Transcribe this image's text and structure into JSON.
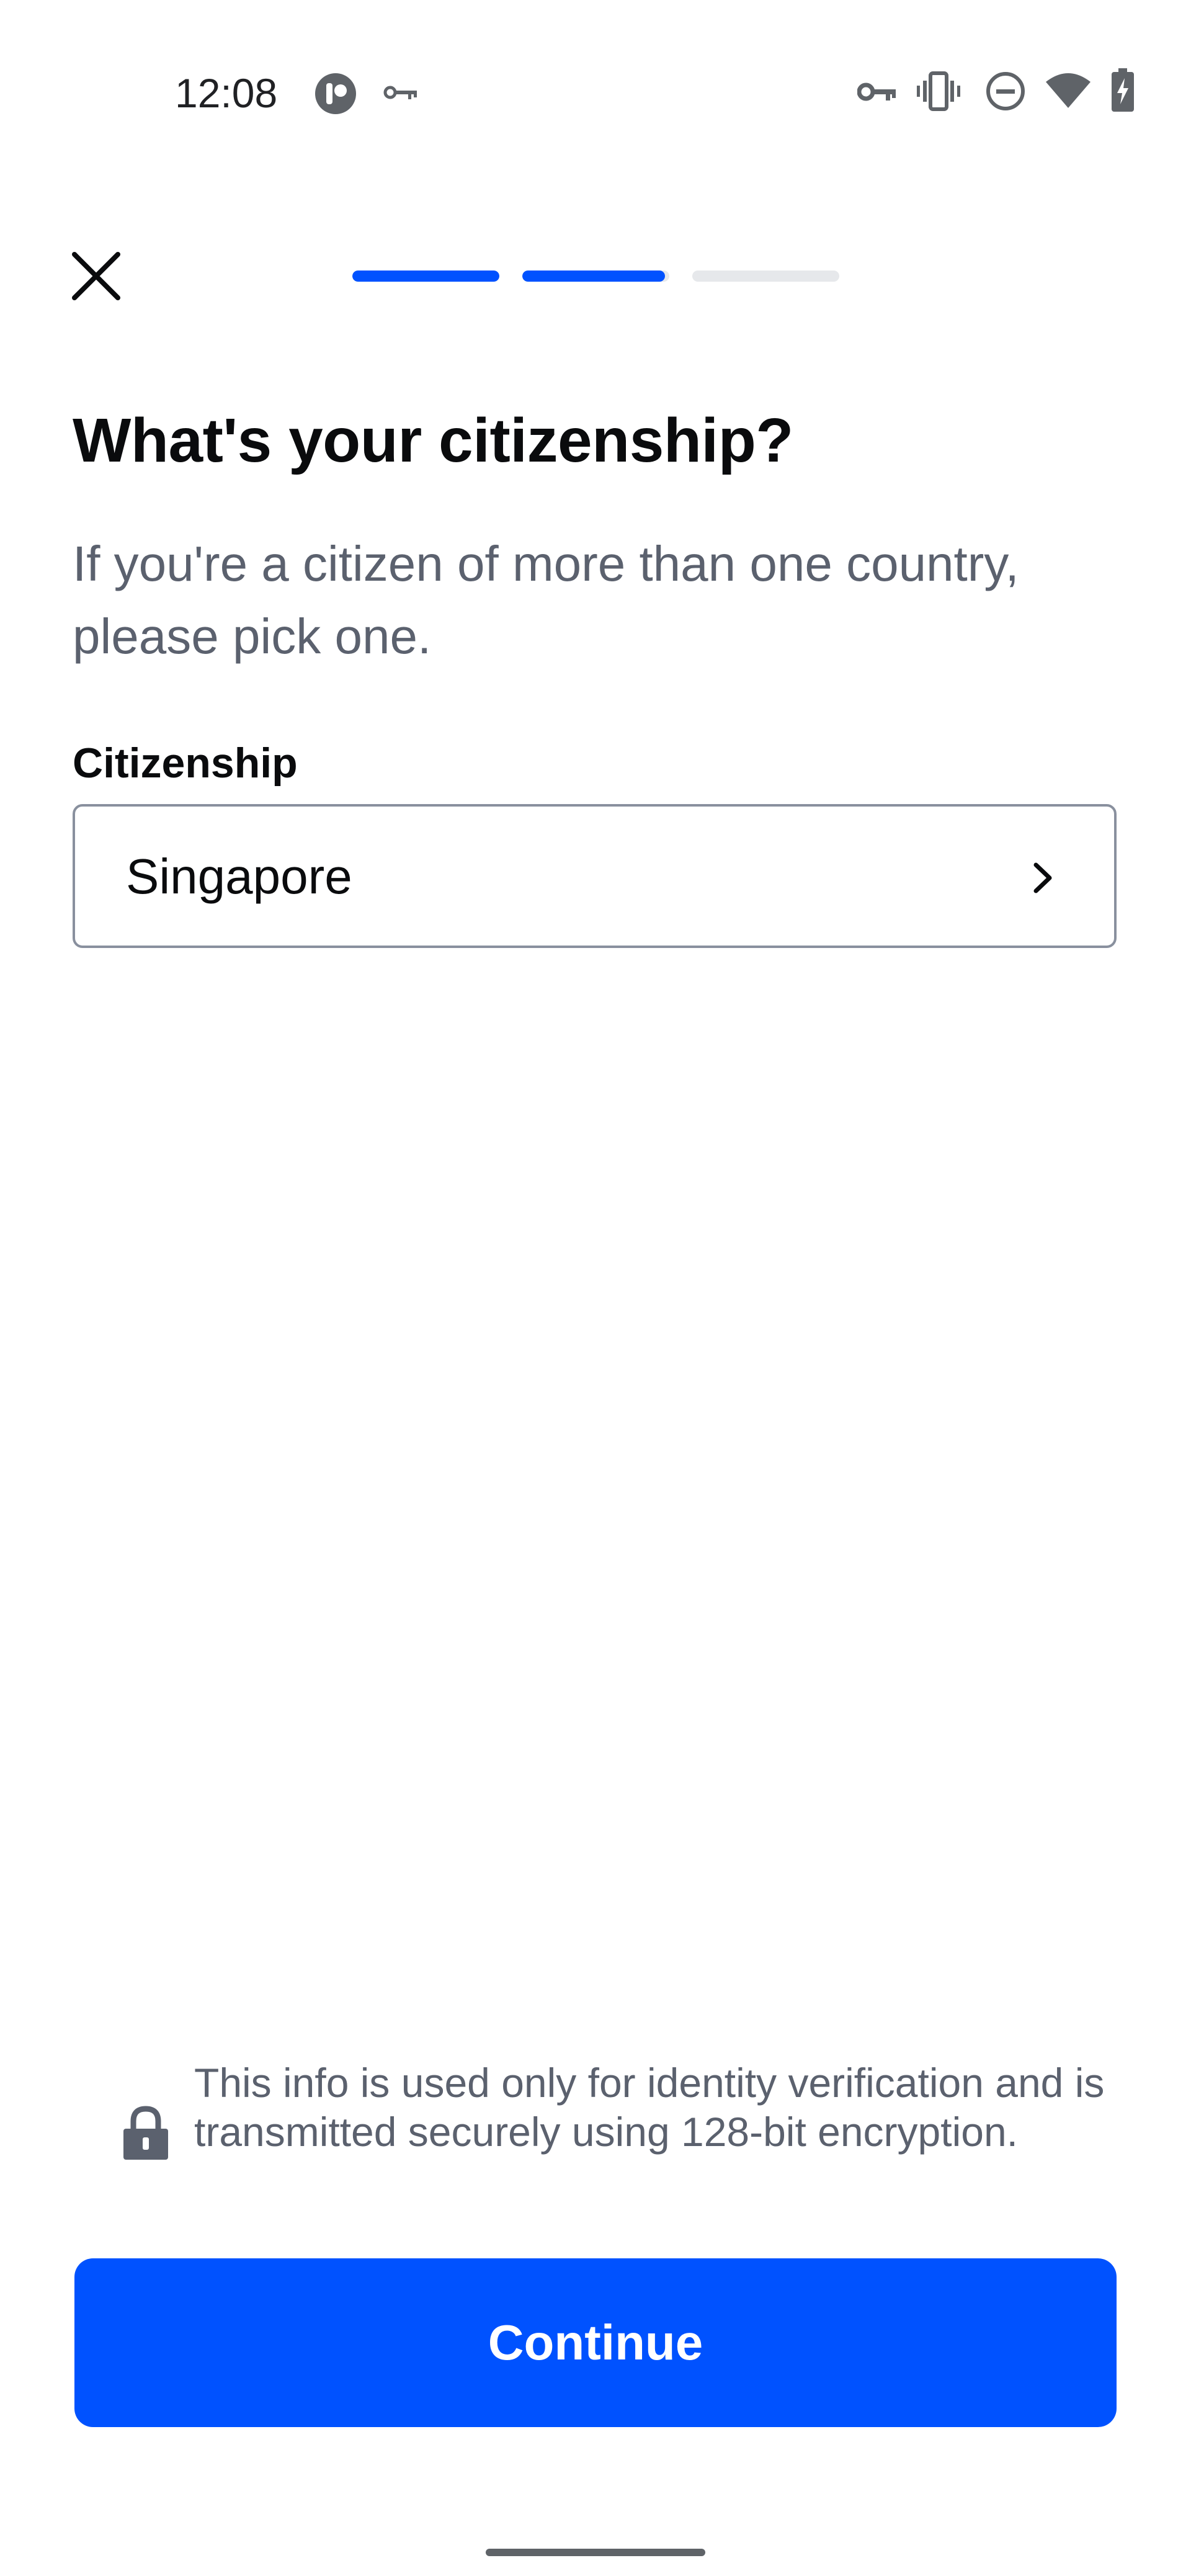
{
  "status_bar": {
    "time": "12:08",
    "left_icons": [
      "app-notification-icon",
      "vpn-key-icon"
    ],
    "right_icons": [
      "vpn-key-icon",
      "vibrate-icon",
      "do-not-disturb-icon",
      "wifi-icon",
      "battery-charging-icon"
    ]
  },
  "header": {
    "close_icon": "close-icon",
    "progress_steps": [
      {
        "fill": 1.0
      },
      {
        "fill": 0.97
      },
      {
        "fill": 0.0
      }
    ]
  },
  "main": {
    "title": "What's your citizenship?",
    "subtitle": "If you're a citizen of more than one country, please pick one.",
    "field_label": "Citizenship",
    "field_value": "Singapore",
    "field_icon": "chevron-right-icon"
  },
  "footer": {
    "secure_icon": "lock-icon",
    "secure_text": "This info is used only for identity verification and is transmitted securely using 128-bit encryption.",
    "continue_label": "Continue"
  },
  "colors": {
    "accent": "#0052ff",
    "progress_track": "#e6e8eb",
    "text_primary": "#0a0b0d",
    "text_secondary": "#5b616e",
    "border": "#89909e"
  }
}
